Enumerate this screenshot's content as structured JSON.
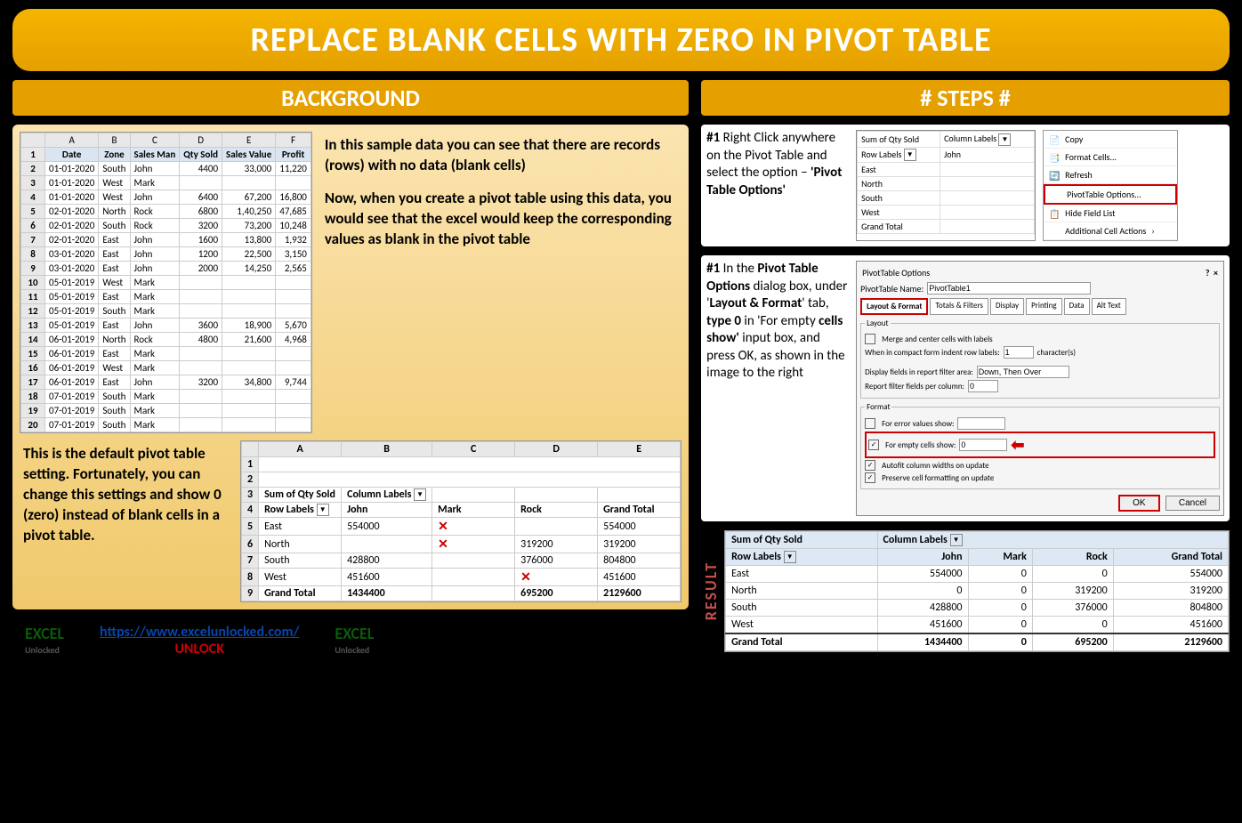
{
  "title": "REPLACE BLANK CELLS WITH ZERO IN PIVOT TABLE",
  "sections": {
    "background": "BACKGROUND",
    "steps": "# STEPS #"
  },
  "source_cols": [
    "A",
    "B",
    "C",
    "D",
    "E",
    "F"
  ],
  "source_headers": [
    "Date",
    "Zone",
    "Sales Man",
    "Qty Sold",
    "Sales Value",
    "Profit"
  ],
  "source_data": [
    [
      "01-01-2020",
      "South",
      "John",
      "4400",
      "33,000",
      "11,220"
    ],
    [
      "01-01-2020",
      "West",
      "Mark",
      "",
      "",
      ""
    ],
    [
      "01-01-2020",
      "West",
      "John",
      "6400",
      "67,200",
      "16,800"
    ],
    [
      "02-01-2020",
      "North",
      "Rock",
      "6800",
      "1,40,250",
      "47,685"
    ],
    [
      "02-01-2020",
      "South",
      "Rock",
      "3200",
      "73,200",
      "10,248"
    ],
    [
      "02-01-2020",
      "East",
      "John",
      "1600",
      "13,800",
      "1,932"
    ],
    [
      "03-01-2020",
      "East",
      "John",
      "1200",
      "22,500",
      "3,150"
    ],
    [
      "03-01-2020",
      "East",
      "John",
      "2000",
      "14,250",
      "2,565"
    ],
    [
      "05-01-2019",
      "West",
      "Mark",
      "",
      "",
      ""
    ],
    [
      "05-01-2019",
      "East",
      "Mark",
      "",
      "",
      ""
    ],
    [
      "05-01-2019",
      "South",
      "Mark",
      "",
      "",
      ""
    ],
    [
      "05-01-2019",
      "East",
      "John",
      "3600",
      "18,900",
      "5,670"
    ],
    [
      "06-01-2019",
      "North",
      "Rock",
      "4800",
      "21,600",
      "4,968"
    ],
    [
      "06-01-2019",
      "East",
      "Mark",
      "",
      "",
      ""
    ],
    [
      "06-01-2019",
      "West",
      "Mark",
      "",
      "",
      ""
    ],
    [
      "06-01-2019",
      "East",
      "John",
      "3200",
      "34,800",
      "9,744"
    ],
    [
      "07-01-2019",
      "South",
      "Mark",
      "",
      "",
      ""
    ],
    [
      "07-01-2019",
      "South",
      "Mark",
      "",
      "",
      ""
    ],
    [
      "07-01-2019",
      "South",
      "Mark",
      "",
      "",
      ""
    ]
  ],
  "bg_text1": "In this sample data you can see that there are records (rows) with no data (blank cells)",
  "bg_text2": "Now, when you create a pivot table using this data, you would see that the excel would keep the corresponding values as blank in the pivot table",
  "bg_text3": "This is the default pivot table setting. Fortunately, you can change this settings and show 0 (zero) instead of blank cells in a pivot table.",
  "pivot_default": {
    "cols": [
      "A",
      "B",
      "C",
      "D",
      "E"
    ],
    "sum_label": "Sum of Qty Sold",
    "col_label": "Column Labels",
    "row_label": "Row Labels",
    "headers": [
      "John",
      "Mark",
      "Rock",
      "Grand Total"
    ],
    "rows": [
      [
        "East",
        "554000",
        "X",
        "",
        "554000"
      ],
      [
        "North",
        "",
        "X",
        "319200",
        "319200"
      ],
      [
        "South",
        "428800",
        "",
        "376000",
        "804800"
      ],
      [
        "West",
        "451600",
        "",
        "X",
        "451600"
      ]
    ],
    "grand": [
      "Grand Total",
      "1434400",
      "",
      "695200",
      "2129600"
    ]
  },
  "step1_text_prefix": "#1 ",
  "step1_text": "Right Click anywhere on the Pivot Table and select the option – ",
  "step1_bold": "'Pivot Table Options'",
  "mini_pivot": {
    "sum": "Sum of Qty Sold",
    "col": "Column Labels",
    "row": "Row Labels",
    "john": "John",
    "zones": [
      "East",
      "North",
      "South",
      "West"
    ],
    "gt": "Grand Total"
  },
  "context_menu": [
    "Copy",
    "Format Cells...",
    "Refresh",
    "PivotTable Options...",
    "Hide Field List",
    "Additional Cell Actions"
  ],
  "step2_text_prefix": "#1 ",
  "step2_a": "In the ",
  "step2_b": "Pivot Table Options",
  "step2_c": " dialog box, under '",
  "step2_d": "Layout & Format",
  "step2_e": "' tab, ",
  "step2_f": "type 0",
  "step2_g": " in 'For empty ",
  "step2_h": "cells show'",
  "step2_i": " input box, and press OK, as shown in the image to the right",
  "dialog": {
    "title": "PivotTable Options",
    "name_lbl": "PivotTable Name:",
    "name_val": "PivotTable1",
    "tabs": [
      "Layout & Format",
      "Totals & Filters",
      "Display",
      "Printing",
      "Data",
      "Alt Text"
    ],
    "layout_legend": "Layout",
    "merge": "Merge and center cells with labels",
    "indent": "When in compact form indent row labels:",
    "indent_val": "1",
    "indent_unit": "character(s)",
    "display_fields": "Display fields in report filter area:",
    "display_val": "Down, Then Over",
    "report_filter": "Report filter fields per column:",
    "report_val": "0",
    "format_legend": "Format",
    "error": "For error values show:",
    "empty": "For empty cells show:",
    "empty_val": "0",
    "autofit": "Autofit column widths on update",
    "preserve": "Preserve cell formatting on update",
    "ok": "OK",
    "cancel": "Cancel"
  },
  "result_label": "RESULT",
  "result": {
    "sum": "Sum of Qty Sold",
    "col": "Column Labels",
    "row": "Row Labels",
    "headers": [
      "John",
      "Mark",
      "Rock",
      "Grand Total"
    ],
    "rows": [
      [
        "East",
        "554000",
        "0",
        "0",
        "554000"
      ],
      [
        "North",
        "0",
        "0",
        "319200",
        "319200"
      ],
      [
        "South",
        "428800",
        "0",
        "376000",
        "804800"
      ],
      [
        "West",
        "451600",
        "0",
        "0",
        "451600"
      ]
    ],
    "grand": [
      "Grand Total",
      "1434400",
      "0",
      "695200",
      "2129600"
    ]
  },
  "footer": {
    "url": "https://www.excelunlocked.com/",
    "unlock": "UNLOCK",
    "logo1": "EXCEL",
    "logo2": "Unlocked"
  }
}
